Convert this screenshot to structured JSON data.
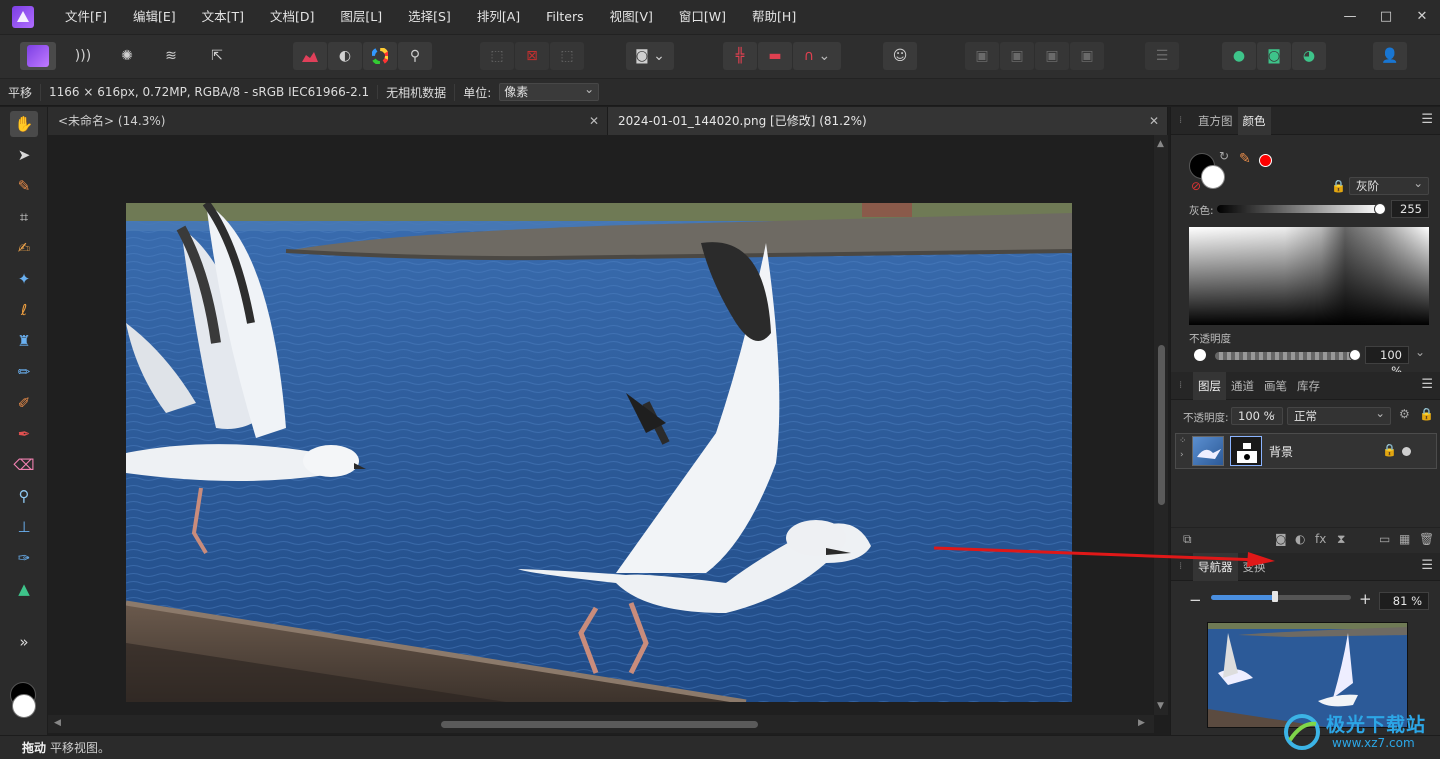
{
  "menubar": {
    "items": [
      "文件[F]",
      "编辑[E]",
      "文本[T]",
      "文档[D]",
      "图层[L]",
      "选择[S]",
      "排列[A]",
      "Filters",
      "视图[V]",
      "窗口[W]",
      "帮助[H]"
    ],
    "window_controls": [
      "—",
      "□",
      "✕"
    ]
  },
  "contextbar": {
    "tool": "平移",
    "info": "1166 × 616px, 0.72MP, RGBA/8 - sRGB IEC61966-2.1",
    "camera": "无相机数据",
    "unit_label": "单位:",
    "unit_value": "像素"
  },
  "tabs": [
    {
      "label": "<未命名> (14.3%)"
    },
    {
      "label": "2024-01-01_144020.png [已修改] (81.2%)"
    }
  ],
  "color_panel": {
    "tabs": [
      "直方图",
      "颜色"
    ],
    "mode": "灰阶",
    "gray_label": "灰色:",
    "gray_value": "255",
    "opacity_label": "不透明度",
    "opacity_value": "100 %",
    "accent_red": "#ff0000"
  },
  "layers_panel": {
    "tabs": [
      "图层",
      "通道",
      "画笔",
      "库存"
    ],
    "opacity_label": "不透明度:",
    "opacity_value": "100 %",
    "blend_mode": "正常",
    "layer_name": "背景"
  },
  "navigator_panel": {
    "tabs": [
      "导航器",
      "变换"
    ],
    "zoom_value": "81 %",
    "zoom_minus": "−",
    "zoom_plus": "+",
    "zoom_fraction": 0.46
  },
  "status": {
    "action": "拖动",
    "text": "平移视图。"
  },
  "watermark": {
    "text_cn": "极光下载站",
    "text_url": "www.xz7.com"
  },
  "icons": {
    "toolbar": [
      "persona-photo-icon",
      "persona-liquify-icon",
      "persona-develop-icon",
      "persona-tonemap-icon",
      "persona-export-icon",
      "levels-icon",
      "auto-contrast-icon",
      "color-wheel-icon",
      "white-balance-icon",
      "select-all-icon",
      "deselect-icon",
      "invert-selection-icon",
      "quick-mask-icon",
      "snapping-icon",
      "assistant-icon",
      "arrange-back-icon",
      "arrange-backward-icon",
      "arrange-forward-icon",
      "arrange-front-icon",
      "align-icon",
      "boolean-add-icon",
      "boolean-subtract-icon",
      "boolean-intersect-icon",
      "account-icon"
    ],
    "tools": [
      "hand-icon",
      "move-icon",
      "color-picker-icon",
      "crop-icon",
      "selection-brush-icon",
      "magic-wand-icon",
      "lasso-icon",
      "flood-fill-icon",
      "paint-brush-icon",
      "dodge-burn-icon",
      "pixel-tool-icon",
      "erase-icon",
      "zoom-icon",
      "clone-icon",
      "retouch-icon",
      "vector-icon",
      "more-tools-icon"
    ]
  }
}
